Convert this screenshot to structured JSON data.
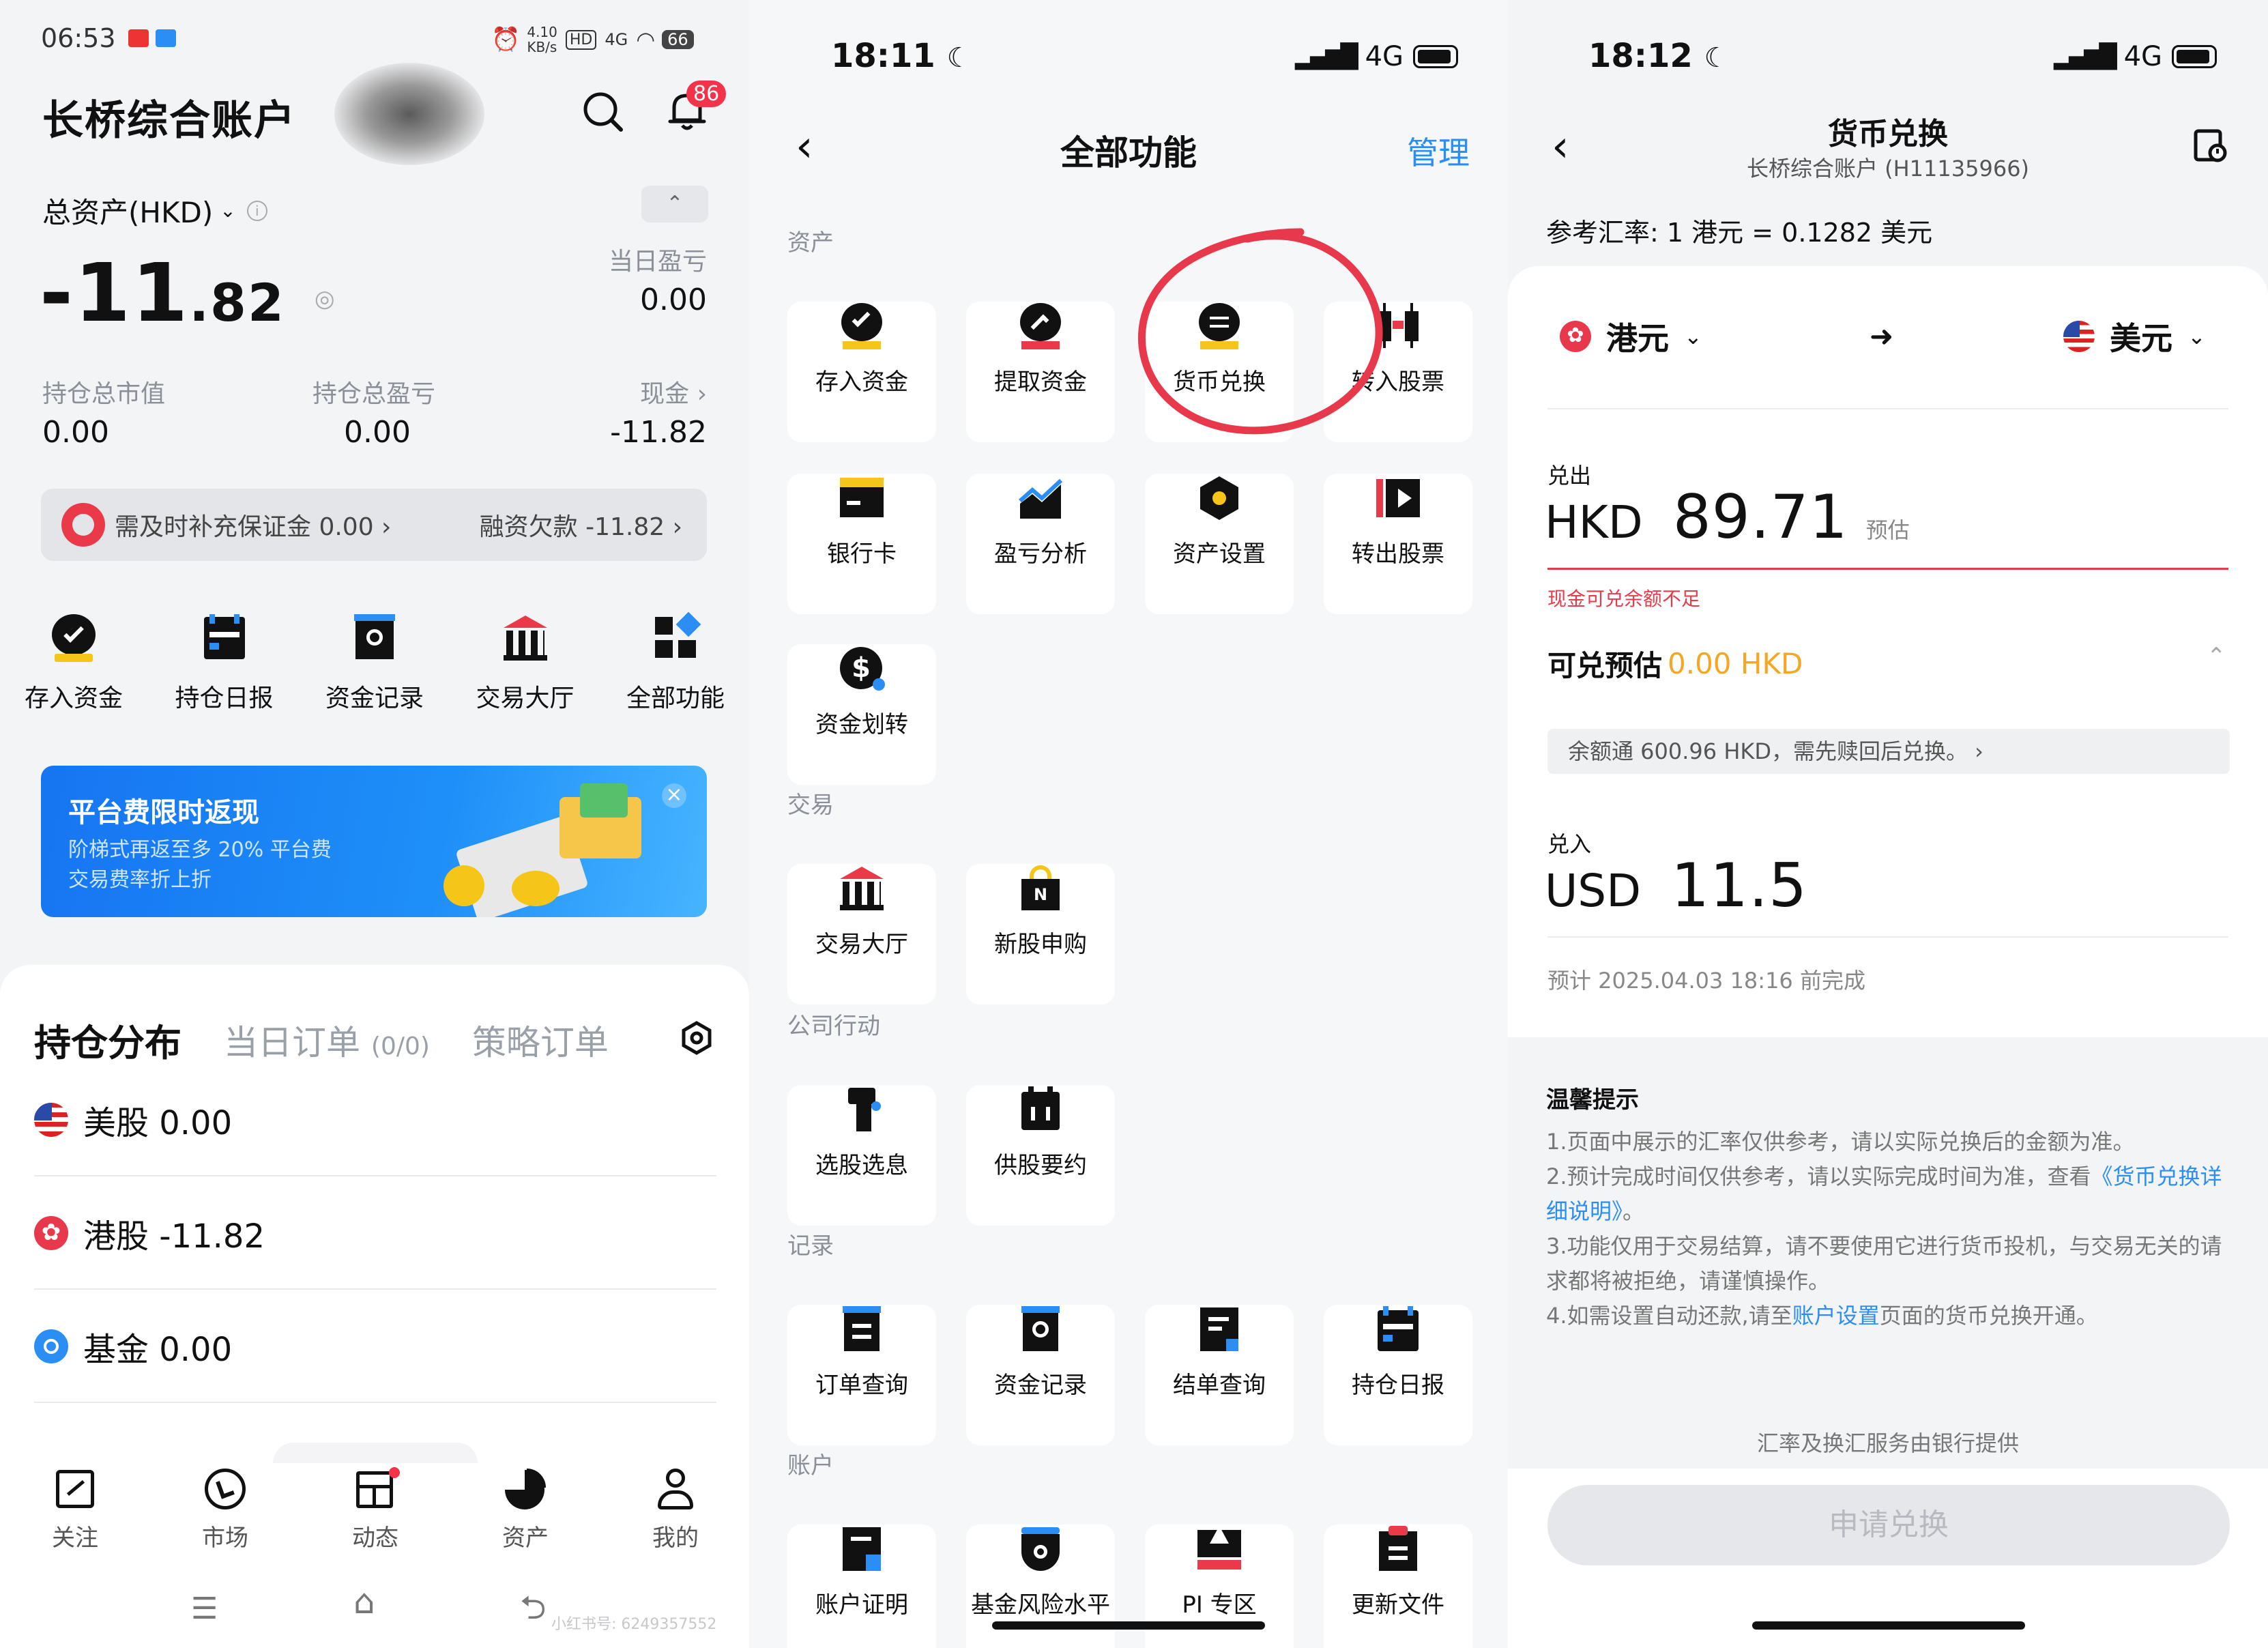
{
  "panel1": {
    "status": {
      "time": "06:53",
      "net_speed": "4.10\nKB/s",
      "hd": "HD",
      "signal": "4G",
      "battery": "66"
    },
    "title": "长桥综合账户",
    "notif_count": "86",
    "asset_label": "总资产(HKD)",
    "total_int": "-11",
    "total_dec": ".82",
    "daily_pl_label": "当日盈亏",
    "daily_pl_value": "0.00",
    "stats": [
      {
        "label": "持仓总市值",
        "value": "0.00"
      },
      {
        "label": "持仓总盈亏",
        "value": "0.00"
      },
      {
        "label": "现金 ›",
        "value": "-11.82"
      }
    ],
    "alert": {
      "left": "需及时补充保证金 0.00 ›",
      "right": "融资欠款 -11.82 ›"
    },
    "quick_actions": [
      "存入资金",
      "持仓日报",
      "资金记录",
      "交易大厅",
      "全部功能"
    ],
    "promo": {
      "title": "平台费限时返现",
      "line1": "阶梯式再返至多 20% 平台费",
      "line2": "交易费率折上折",
      "close": "×"
    },
    "tabs": {
      "holdings": "持仓分布",
      "orders": "当日订单",
      "orders_count": "(0/0)",
      "strategy": "策略订单"
    },
    "holdings": [
      {
        "label": "美股 0.00",
        "flag": "us"
      },
      {
        "label": "港股 -11.82",
        "flag": "hk"
      },
      {
        "label": "基金 0.00",
        "flag": "fund"
      }
    ],
    "nav": [
      "关注",
      "市场",
      "动态",
      "资产",
      "我的"
    ],
    "watermark": "小红书号: 6249357552"
  },
  "panel2": {
    "status": {
      "time": "18:11",
      "signal": "4G"
    },
    "title": "全部功能",
    "manage": "管理",
    "sections": [
      {
        "label": "资产",
        "items": [
          "存入资金",
          "提取资金",
          "货币兑换",
          "转入股票",
          "银行卡",
          "盈亏分析",
          "资产设置",
          "转出股票",
          "资金划转"
        ]
      },
      {
        "label": "交易",
        "items": [
          "交易大厅",
          "新股申购"
        ]
      },
      {
        "label": "公司行动",
        "items": [
          "选股选息",
          "供股要约"
        ]
      },
      {
        "label": "记录",
        "items": [
          "订单查询",
          "资金记录",
          "结单查询",
          "持仓日报"
        ]
      },
      {
        "label": "账户",
        "items": [
          "账户证明",
          "基金风险水平",
          "PI 专区",
          "更新文件"
        ]
      }
    ]
  },
  "panel3": {
    "status": {
      "time": "18:12",
      "signal": "4G"
    },
    "title": "货币兑换",
    "subtitle": "长桥综合账户 (H11135966)",
    "rate": "参考汇率: 1 港元 = 0.1282 美元",
    "from_ccy": "港元",
    "to_ccy": "美元",
    "out_label": "兑出",
    "out_ccy": "HKD",
    "out_amount": "89.71",
    "out_est": "预估",
    "error": "现金可兑余额不足",
    "avail_label": "可兑预估",
    "avail_value": "0.00 HKD",
    "yuetong": "余额通 600.96 HKD，需先赎回后兑换。 ›",
    "in_label": "兑入",
    "in_ccy": "USD",
    "in_amount": "11.5",
    "eta": "预计 2025.04.03 18:16 前完成",
    "tips_title": "温馨提示",
    "tip1": "1.页面中展示的汇率仅供参考，请以实际兑换后的金额为准。",
    "tip2a": "2.预计完成时间仅供参考，请以实际完成时间为准，查看",
    "tip2_link": "《货币兑换详细说明》",
    "tip2b": "。",
    "tip3": "3.功能仅用于交易结算，请不要使用它进行货币投机，与交易无关的请求都将被拒绝，请谨慎操作。",
    "tip4a": "4.如需设置自动还款,请至",
    "tip4_link": "账户设置",
    "tip4b": "页面的货币兑换开通。",
    "provider": "汇率及换汇服务由银行提供",
    "apply": "申请兑换"
  },
  "colors": {
    "brand_blue": "#2b8ef5",
    "alert_red": "#ea3a4a",
    "highlight_orange": "#f5a623",
    "annotation_red": "#e8384b"
  }
}
